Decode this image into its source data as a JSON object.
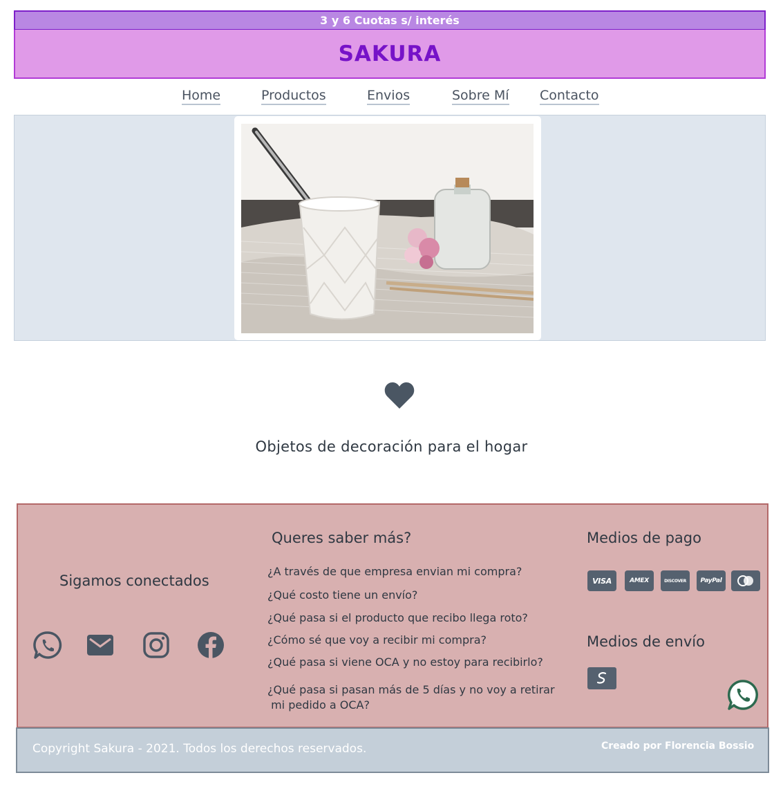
{
  "promo": {
    "text": "3 y 6 Cuotas s/ interés"
  },
  "brand": {
    "title": "SAKURA"
  },
  "nav": {
    "items": [
      {
        "label": "Home"
      },
      {
        "label": "Productos"
      },
      {
        "label": "Envios"
      },
      {
        "label": "Sobre Mí"
      },
      {
        "label": "Contacto"
      }
    ]
  },
  "hero": {
    "image_icon": "photo-mate-cup-with-flowers"
  },
  "intro": {
    "icon": "heart-icon",
    "tagline": "Objetos de decoración para el hogar"
  },
  "footer": {
    "social": {
      "title": "Sigamos conectados",
      "icons": [
        "whatsapp-icon",
        "mail-icon",
        "instagram-icon",
        "facebook-icon"
      ]
    },
    "faq": {
      "title": "Queres saber más?",
      "items": [
        "¿A través de que empresa envian mi compra?",
        "¿Qué costo tiene un envío?",
        "¿Qué pasa si el producto que recibo llega roto?",
        "¿Cómo sé que voy a recibir mi compra?",
        "¿Qué pasa si viene OCA y no estoy para recibirlo?",
        "¿Qué pasa si pasan más de 5 días y no voy a retirar",
        " mi pedido a OCA?"
      ]
    },
    "payment": {
      "title": "Medios de pago",
      "cards": [
        "VISA",
        "AMEX",
        "DISCOVER",
        "PayPal",
        ""
      ]
    },
    "shipping": {
      "title": "Medios de envío",
      "icon": "oca-icon"
    }
  },
  "copyright": {
    "left": "Copyright Sakura - 2021. Todos los derechos reservados.",
    "right": "Creado por Florencia Bossio"
  },
  "colors": {
    "promo_bg": "#b987e3",
    "brand_bg": "#e09ae8",
    "brand_text": "#7612c8",
    "hero_bg": "#dfe6ee",
    "footer_bg": "#d8b0b0",
    "copyright_bg": "#c4cfd9",
    "icon_dark": "#55616f"
  }
}
